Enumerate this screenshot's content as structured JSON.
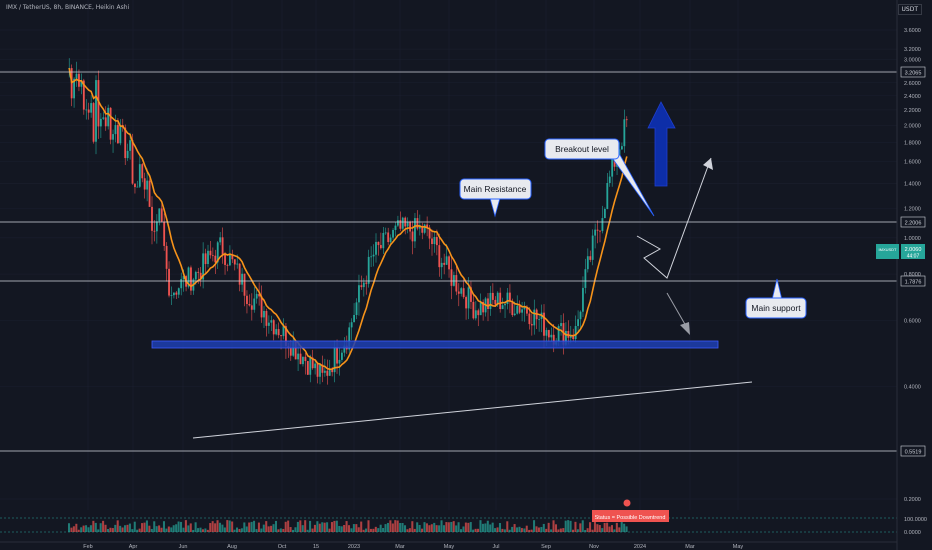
{
  "header": {
    "symbol_line": "IMX / TetherUS, 8h, BINANCE, Heikin Ashi",
    "currency": "USDT"
  },
  "colors": {
    "background": "#131722",
    "up": "#26a69a",
    "down": "#ef5350",
    "ma": "#f7931a",
    "zone": "#1f3fb3",
    "level_line": "#d1d4dc",
    "callout_border": "#2962ff",
    "big_arrow": "#0d2ea8"
  },
  "chart_data": {
    "type": "candlestick",
    "y_scale": "log",
    "ylim": [
      0.2,
      4.0
    ],
    "y_ticks": [
      "3.6000",
      "3.2000",
      "3.0000",
      "2.8000",
      "2.6000",
      "2.4000",
      "2.2000",
      "2.0000",
      "1.8000",
      "1.6000",
      "1.4000",
      "1.2000",
      "1.0000",
      "0.8000",
      "0.6000",
      "0.4000",
      "0.2000"
    ],
    "x_ticks": [
      "Feb",
      "Apr",
      "Jun",
      "Aug",
      "Oct",
      "15",
      "2023",
      "Mar",
      "May",
      "Jul",
      "Sep",
      "Nov",
      "2024",
      "Mar",
      "May"
    ],
    "price_series_approx": [
      {
        "period": "Feb 2022",
        "value": 2.8
      },
      {
        "period": "Mar 2022",
        "value": 2.2
      },
      {
        "period": "Apr 2022",
        "value": 1.9
      },
      {
        "period": "May 2022",
        "value": 1.35
      },
      {
        "period": "Jun 2022",
        "value": 0.72
      },
      {
        "period": "Jul 2022",
        "value": 0.8
      },
      {
        "period": "Aug 2022",
        "value": 0.95
      },
      {
        "period": "Sep 2022",
        "value": 0.72
      },
      {
        "period": "Oct 2022",
        "value": 0.6
      },
      {
        "period": "Nov 2022",
        "value": 0.5
      },
      {
        "period": "Dec 2022",
        "value": 0.42
      },
      {
        "period": "Jan 2023",
        "value": 0.55
      },
      {
        "period": "Feb 2023",
        "value": 0.9
      },
      {
        "period": "Mar 2023",
        "value": 1.05
      },
      {
        "period": "Apr 2023",
        "value": 1.05
      },
      {
        "period": "May 2023",
        "value": 0.8
      },
      {
        "period": "Jun 2023",
        "value": 0.65
      },
      {
        "period": "Jul 2023",
        "value": 0.68
      },
      {
        "period": "Aug 2023",
        "value": 0.65
      },
      {
        "period": "Sep 2023",
        "value": 0.56
      },
      {
        "period": "Oct 2023",
        "value": 0.56
      },
      {
        "period": "Nov 2023",
        "value": 1.15
      },
      {
        "period": "Dec 2023",
        "value": 2.03
      }
    ],
    "levels": {
      "top": "3.2065",
      "resistance": "2.2006",
      "support": "1.7876",
      "bottom": "0.5519"
    },
    "last_price": {
      "symbol": "IMXUSDT",
      "value": "2.0060",
      "countdown": "44:07"
    },
    "annotations": {
      "breakout": "Breakout level",
      "resistance": "Main Resistance",
      "support": "Main support"
    },
    "indicator": {
      "label": "Status = Possible Downtrend",
      "ticks": [
        "100.0000",
        "0.0000"
      ]
    }
  }
}
